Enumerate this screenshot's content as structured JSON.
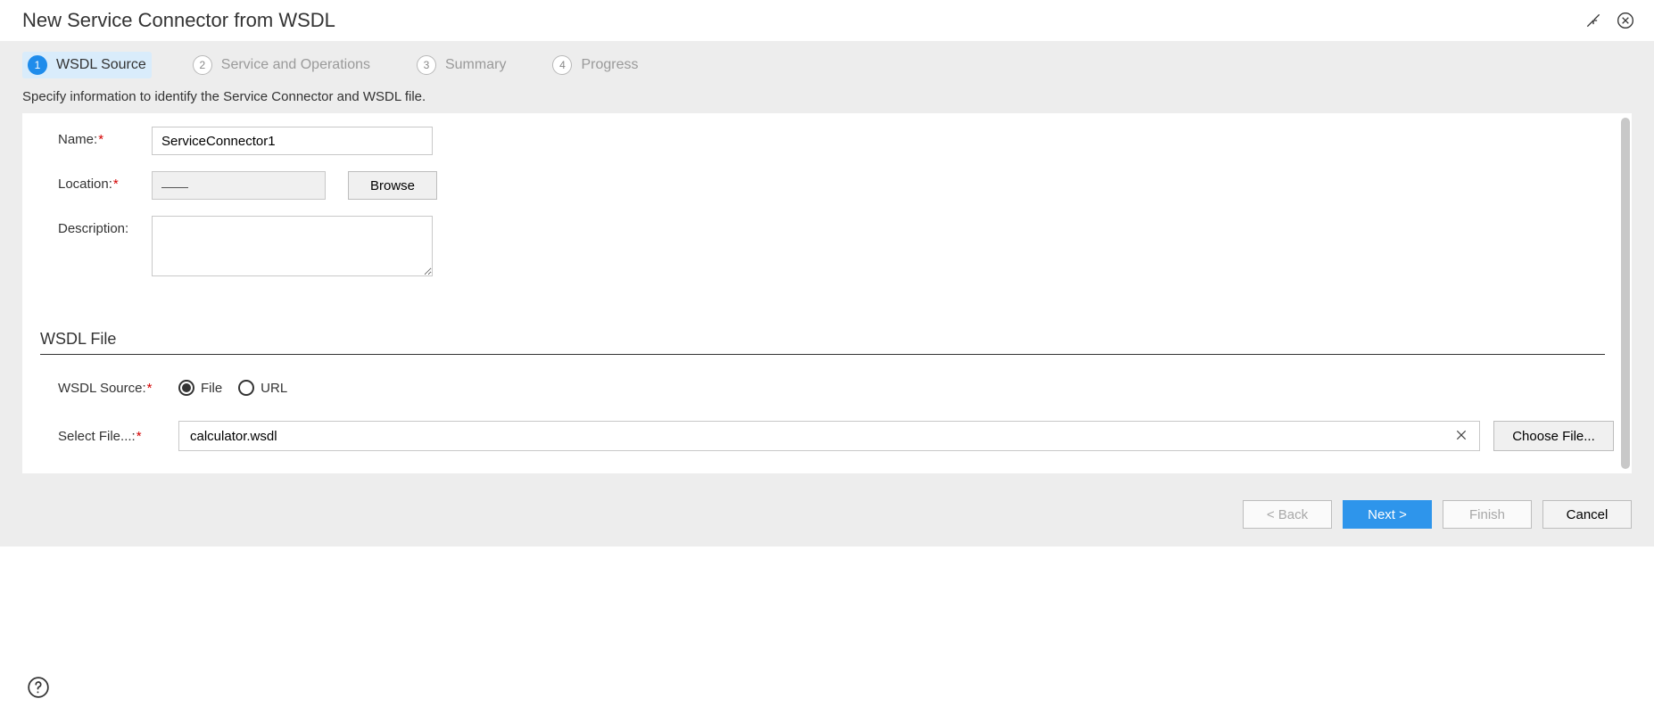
{
  "dialog": {
    "title": "New Service Connector from WSDL"
  },
  "steps": [
    {
      "num": "1",
      "label": "WSDL Source",
      "active": true
    },
    {
      "num": "2",
      "label": "Service and Operations",
      "active": false
    },
    {
      "num": "3",
      "label": "Summary",
      "active": false
    },
    {
      "num": "4",
      "label": "Progress",
      "active": false
    }
  ],
  "instruction": "Specify information to identify the Service Connector and WSDL file.",
  "form": {
    "name_label": "Name:",
    "name_value": "ServiceConnector1",
    "location_label": "Location:",
    "location_value": "",
    "browse_label": "Browse",
    "description_label": "Description:",
    "description_value": ""
  },
  "wsdl": {
    "section_title": "WSDL File",
    "source_label": "WSDL Source:",
    "option_file": "File",
    "option_url": "URL",
    "selected_option": "File",
    "select_file_label": "Select File...:",
    "select_file_value": "calculator.wsdl",
    "choose_file_label": "Choose File..."
  },
  "footer": {
    "back": "< Back",
    "next": "Next >",
    "finish": "Finish",
    "cancel": "Cancel"
  }
}
